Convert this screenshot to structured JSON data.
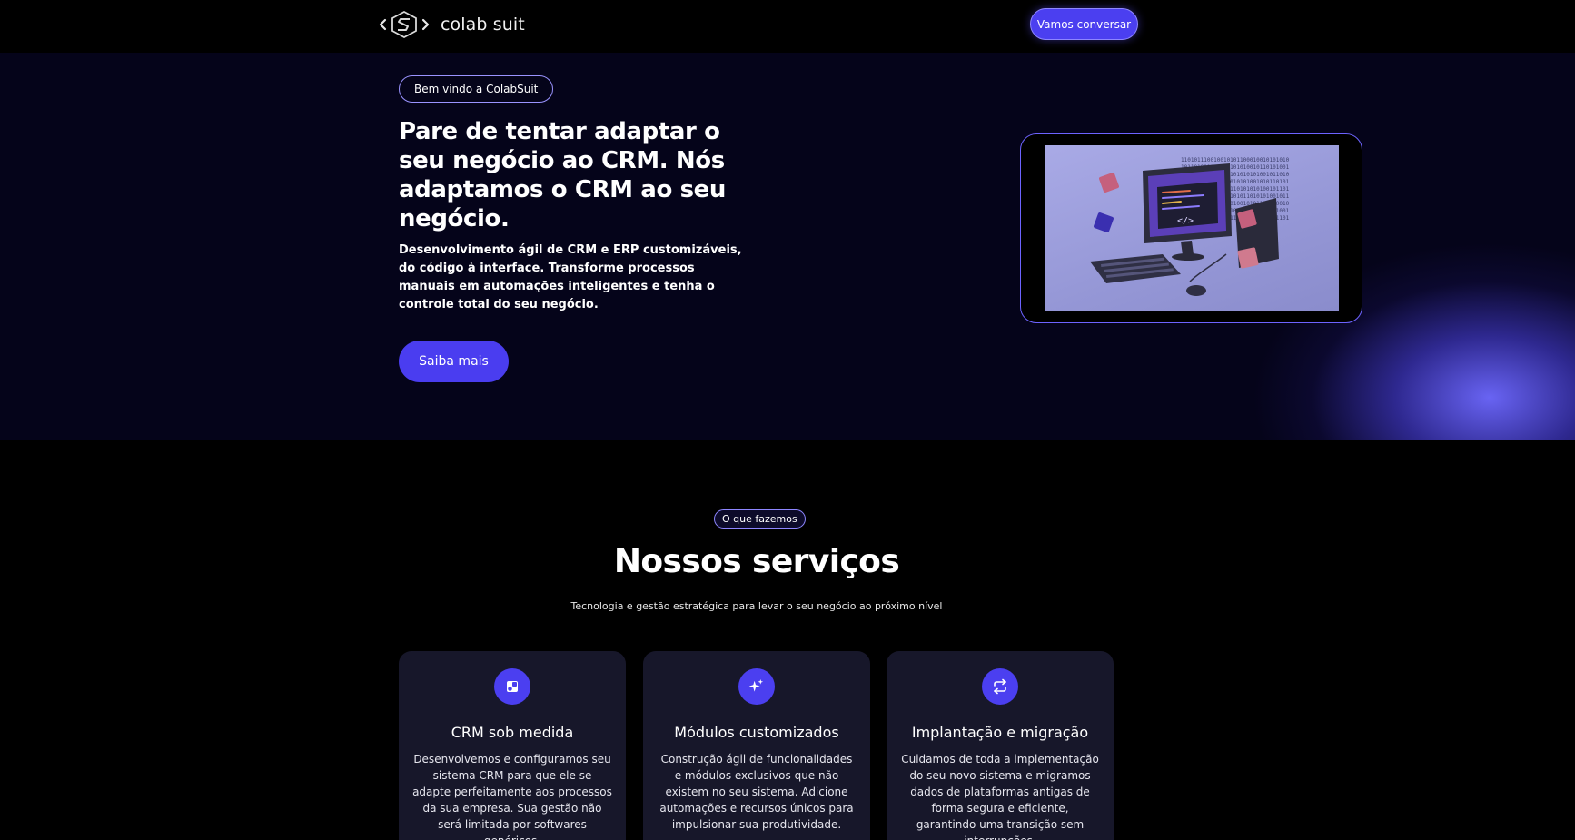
{
  "header": {
    "brand": "colab suit",
    "cta_label": "Vamos conversar"
  },
  "hero": {
    "welcome": "Bem vindo a ColabSuit",
    "title": "Pare de tentar adaptar o seu negócio ao CRM. Nós adaptamos o CRM ao seu negócio.",
    "description": "Desenvolvimento ágil de CRM e ERP customizáveis, do código à interface. Transforme processos manuais em automações inteligentes e tenha o controle total do seu negócio.",
    "cta_label": "Saiba mais",
    "image_icon": "computer-illustration"
  },
  "services": {
    "pill": "O que fazemos",
    "title": "Nossos serviços",
    "subtitle": "Tecnologia e gestão estratégica para levar o seu negócio ao próximo nível",
    "cards": [
      {
        "icon": "shapes-icon",
        "title": "CRM sob medida",
        "text": "Desenvolvemos e configuramos seu sistema CRM para que ele se adapte perfeitamente aos processos da sua empresa. Sua gestão não será limitada por softwares genéricos."
      },
      {
        "icon": "sparkles-icon",
        "title": "Módulos customizados",
        "text": "Construção ágil de funcionalidades e módulos exclusivos que não existem no seu sistema. Adicione automações e recursos únicos para impulsionar sua produtividade."
      },
      {
        "icon": "repeat-icon",
        "title": "Implantação e migração",
        "text": "Cuidamos de toda a implementação do seu novo sistema e migramos dados de plataformas antigas de forma segura e eficiente, garantindo uma transição sem interrupções."
      }
    ]
  },
  "colors": {
    "accent": "#4b3ff0",
    "background": "#000000",
    "hero_background": "#05041a",
    "card_background": "#17172a"
  }
}
